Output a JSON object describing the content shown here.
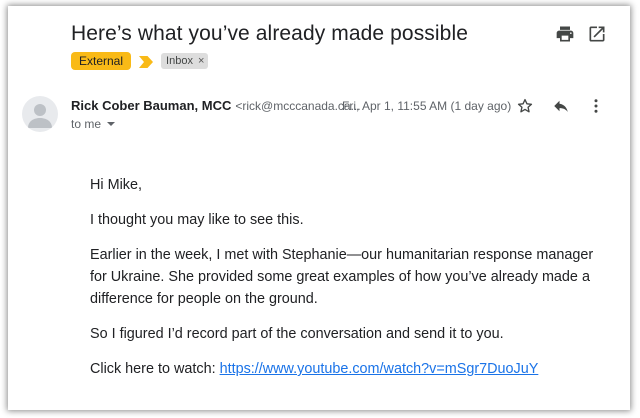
{
  "email": {
    "subject": "Here’s what you’ve already made possible",
    "labels": {
      "external": "External",
      "inbox": "Inbox",
      "inbox_remove": "×"
    },
    "sender": {
      "name": "Rick Cober Bauman, MCC",
      "email": "<rick@mcccanada.ca..."
    },
    "date": "Fri, Apr 1, 11:55 AM (1 day ago)",
    "to": "to me",
    "body": {
      "greeting": "Hi Mike,",
      "para1": "I thought you may like to see this.",
      "para2": "Earlier in the week, I met with Stephanie—our humanitarian response manager for Ukraine. She provided some great examples of how you’ve already made a difference for people on the ground.",
      "para3": "So I figured I’d record part of the conversation and send it to you.",
      "watch_prefix": "Click here to watch:",
      "watch_link": "https://www.youtube.com/watch?v=mSgr7DuoJuY"
    }
  },
  "icons": {
    "print": "print-icon",
    "open_new_window": "open-in-new-window-icon",
    "avatar": "person-avatar-icon",
    "star": "star-icon",
    "reply": "reply-icon",
    "more": "more-vert-icon",
    "importance": "importance-marker-icon",
    "expand_recipients": "chevron-down-icon"
  },
  "colors": {
    "external_label": "#f9ba17",
    "importance_marker": "#f9ba17",
    "inbox_label": "#dddddd",
    "link": "#1a73e8",
    "text": "#202124",
    "secondary_text": "#5f6368"
  }
}
